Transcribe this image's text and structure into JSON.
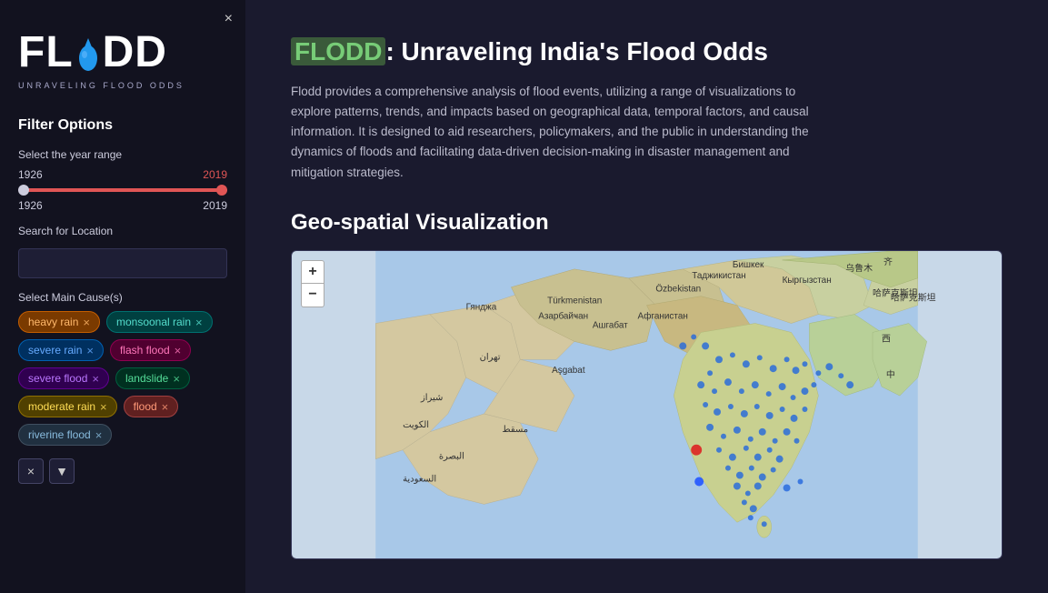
{
  "sidebar": {
    "close_label": "×",
    "logo_letters": "FL DD",
    "logo_subtitle": "UNRAVELING FLOOD ODDS",
    "filter_title": "Filter Options",
    "year_range_label": "Select the year range",
    "year_start": "1926",
    "year_end": "2019",
    "year_start_val": "1926",
    "year_end_val": "2019",
    "location_label": "Search for Location",
    "location_placeholder": "",
    "causes_label": "Select Main Cause(s)",
    "chips": [
      {
        "label": "heavy rain",
        "color": "orange"
      },
      {
        "label": "monsoonal rain",
        "color": "teal"
      },
      {
        "label": "severe rain",
        "color": "blue"
      },
      {
        "label": "flash flood",
        "color": "red"
      },
      {
        "label": "severe flood",
        "color": "purple"
      },
      {
        "label": "landslide",
        "color": "green"
      },
      {
        "label": "moderate rain",
        "color": "yellow"
      },
      {
        "label": "flood",
        "color": "coral"
      },
      {
        "label": "riverine flood",
        "color": "slate"
      }
    ],
    "clear_icon": "×",
    "dropdown_up": "▲",
    "dropdown_down": "▼"
  },
  "main": {
    "title_highlight": "FLODD",
    "title_rest": ": Unraveling India's Flood Odds",
    "description": "Flodd provides a comprehensive analysis of flood events, utilizing a range of visualizations to explore patterns, trends, and impacts based on geographical data, temporal factors, and causal information. It is designed to aid researchers, policymakers, and the public in understanding the dynamics of floods and facilitating data-driven decision-making in disaster management and mitigation strategies.",
    "section_geo": "Geo-spatial Visualization",
    "map_zoom_in": "+",
    "map_zoom_out": "−"
  }
}
